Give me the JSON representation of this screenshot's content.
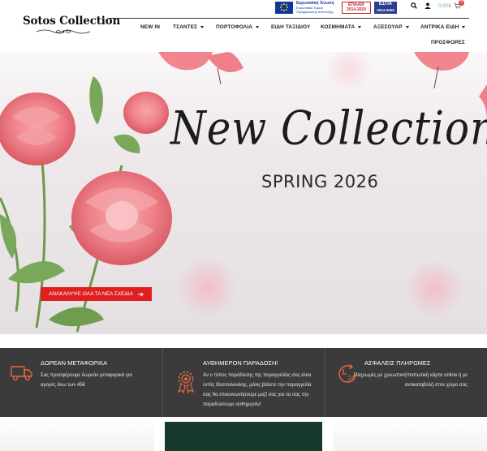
{
  "brand": {
    "name": "Sotos Collection"
  },
  "eu_banner": {
    "eu_title": "Ευρωπαϊκή Ένωση",
    "eu_subtitle": "Ευρωπαϊκό Ταμείο Περιφερειακής Ανάπτυξης",
    "program": "ΕΠΑνΕΚ",
    "program_period": "2014-2020",
    "espa": "ΕΣΠΑ",
    "espa_period": "2014-2020"
  },
  "header": {
    "cart_total": "0,00€",
    "cart_count": "0"
  },
  "nav": {
    "items": [
      {
        "label": "NEW IN"
      },
      {
        "label": "ΤΣΑΝΤΕΣ"
      },
      {
        "label": "ΠΟΡΤΟΦΟΛΙΑ"
      },
      {
        "label": "ΕΙΔΗ ΤΑΞΙΔΙΟΥ"
      },
      {
        "label": "ΚΟΣΜΗΜΑΤΑ"
      },
      {
        "label": "ΑΞΕΣΟΥΑΡ"
      },
      {
        "label": "ΑΝΤΡΙΚΑ ΕΙΔΗ"
      },
      {
        "label": "ΠΡΟΣΦΟΡΕΣ"
      }
    ]
  },
  "hero": {
    "title": "New Collection",
    "subtitle": "SPRING 2026",
    "cta_label": "ΑΝΑΚΑΛΥΨΕ ΟΛΑ ΤΑ ΝΕΑ ΣΧΕΔΙΑ"
  },
  "features": [
    {
      "icon": "truck-icon",
      "title": "ΔΩΡΕΑΝ ΜΕΤΑΦΟΡΙΚΑ",
      "text": "Σας προσφέρουμε δωρεάν μεταφορικά για αγορές άνω των 45€"
    },
    {
      "icon": "award-badge-icon",
      "title": "ΑΥΘΗΜΕΡΟΝ ΠΑΡΑΔΟΣΗ!",
      "text": "Αν ο τόπος παράδοσης της παραγγελίας σας είναι εντός Θεσσαλονίκης, μόλις βάλετε την παραγγελία σας θα επικοινωνήσουμε μαζί σας για να σας την παραδώσουμε αυθημερόν!"
    },
    {
      "icon": "clock-24-icon",
      "title": "ΑΣΦΑΛΕΙΣ ΠΛΗΡΩΜΕΣ",
      "text": "Πληρωμές με χρεωστική/πιστωτική κάρτα online ή με αντικαταβολή στον χώρο σας"
    }
  ],
  "colors": {
    "accent": "#e02020",
    "cart_price": "#6fbf73",
    "feature_bar": "#3b3b3b",
    "feature_icon": "#e8683c",
    "promo_dark": "#17382c"
  }
}
